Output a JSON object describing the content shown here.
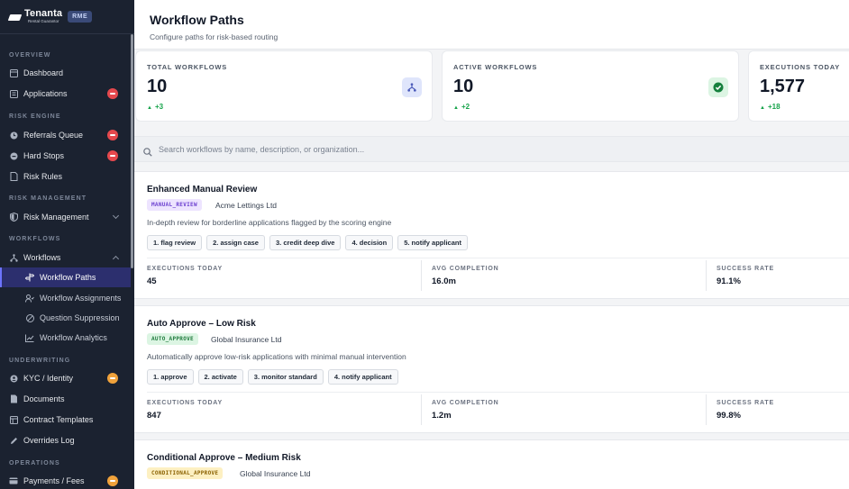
{
  "brand": {
    "name": "Tenanta",
    "sub": "Rental Guarantor",
    "badge": "RME"
  },
  "sidebar": {
    "sections": {
      "overview": "OVERVIEW",
      "risk_engine": "RISK ENGINE",
      "risk_management": "RISK MANAGEMENT",
      "workflows": "WORKFLOWS",
      "underwriting": "UNDERWRITING",
      "operations": "OPERATIONS"
    },
    "items": {
      "dashboard": "Dashboard",
      "applications": "Applications",
      "referrals_queue": "Referrals Queue",
      "hard_stops": "Hard Stops",
      "risk_rules": "Risk Rules",
      "risk_management": "Risk Management",
      "workflows": "Workflows",
      "workflow_paths": "Workflow Paths",
      "workflow_assignments": "Workflow Assignments",
      "question_suppression": "Question Suppression",
      "workflow_analytics": "Workflow Analytics",
      "kyc_identity": "KYC / Identity",
      "documents": "Documents",
      "contract_templates": "Contract Templates",
      "overrides_log": "Overrides Log",
      "payments_fees": "Payments / Fees"
    }
  },
  "header": {
    "title": "Workflow Paths",
    "subtitle": "Configure paths for risk-based routing"
  },
  "stats": [
    {
      "label": "TOTAL WORKFLOWS",
      "value": "10",
      "delta": "+3"
    },
    {
      "label": "ACTIVE WORKFLOWS",
      "value": "10",
      "delta": "+2"
    },
    {
      "label": "EXECUTIONS TODAY",
      "value": "1,577",
      "delta": "+18"
    }
  ],
  "search": {
    "placeholder": "Search workflows by name, description, or organization..."
  },
  "metric_labels": {
    "executions": "EXECUTIONS TODAY",
    "completion": "AVG COMPLETION",
    "success": "SUCCESS RATE"
  },
  "workflows": [
    {
      "title": "Enhanced Manual Review",
      "code": "MANUAL_REVIEW",
      "org": "Acme Lettings Ltd",
      "description": "In-depth review for borderline applications flagged by the scoring engine",
      "steps": [
        "1. flag review",
        "2. assign case",
        "3. credit deep dive",
        "4. decision",
        "5. notify applicant"
      ],
      "executions": "45",
      "completion": "16.0m",
      "success": "91.1%"
    },
    {
      "title": "Auto Approve – Low Risk",
      "code": "AUTO_APPROVE",
      "org": "Global Insurance Ltd",
      "description": "Automatically approve low-risk applications with minimal manual intervention",
      "steps": [
        "1. approve",
        "2. activate",
        "3. monitor standard",
        "4. notify applicant"
      ],
      "executions": "847",
      "completion": "1.2m",
      "success": "99.8%"
    },
    {
      "title": "Conditional Approve – Medium Risk",
      "code": "CONDITIONAL_APPROVE",
      "org": "Global Insurance Ltd"
    }
  ],
  "colors": {
    "sidebar_bg": "#1b2230",
    "active_bg": "#2c2f6e",
    "accent": "#6d74ff",
    "success": "#16a34a",
    "badge_red": "#e5484d",
    "badge_orange": "#f0a23b",
    "tag_manual": "#ede4ff",
    "tag_auto": "#dcf5e3",
    "tag_conditional": "#fdf0c2"
  }
}
